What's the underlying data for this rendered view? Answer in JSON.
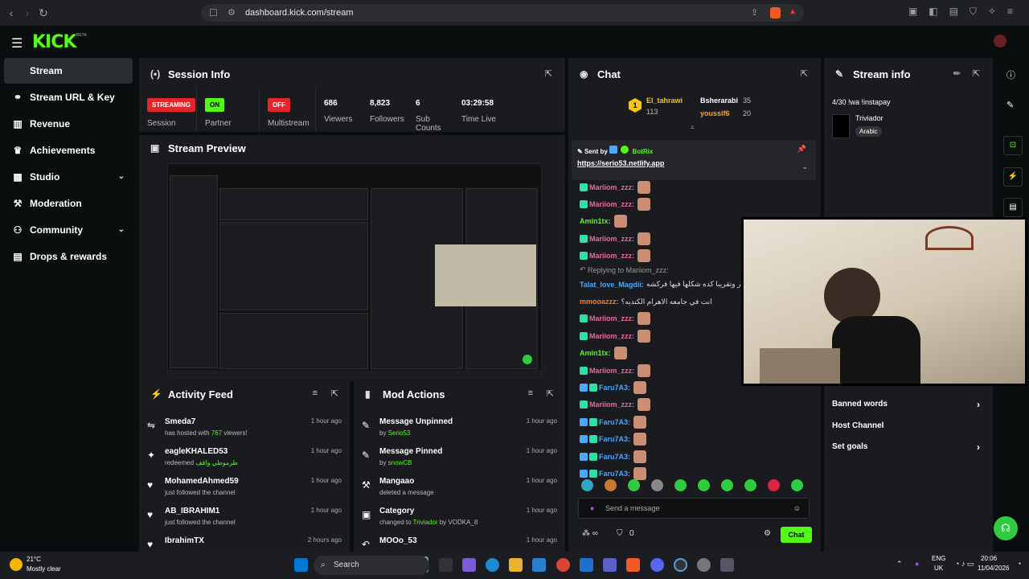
{
  "browser": {
    "url": "dashboard.kick.com/stream"
  },
  "brand": {
    "logo": "KICK",
    "logo_sup": "BETA"
  },
  "sidebar": {
    "items": [
      {
        "label": "Stream",
        "icon": "broadcast-icon"
      },
      {
        "label": "Stream URL & Key",
        "icon": "link-icon"
      },
      {
        "label": "Revenue",
        "icon": "revenue-icon"
      },
      {
        "label": "Achievements",
        "icon": "trophy-icon"
      },
      {
        "label": "Studio",
        "icon": "grid-icon",
        "has_chevron": true
      },
      {
        "label": "Moderation",
        "icon": "hammer-icon"
      },
      {
        "label": "Community",
        "icon": "community-icon",
        "has_chevron": true
      },
      {
        "label": "Drops & rewards",
        "icon": "gift-icon"
      }
    ]
  },
  "session": {
    "title": "Session Info",
    "cells": [
      {
        "badge": "STREAMING",
        "label": "Session"
      },
      {
        "badge": "ON",
        "label": "Partner"
      },
      {
        "badge": "OFF",
        "label": "Multistream"
      },
      {
        "value": "686",
        "label": "Viewers"
      },
      {
        "value": "8,823",
        "label": "Followers"
      },
      {
        "value": "6",
        "label": "Sub Counts"
      },
      {
        "value": "03:29:58",
        "label": "Time Live"
      }
    ]
  },
  "preview": {
    "title": "Stream Preview"
  },
  "activity": {
    "title": "Activity Feed",
    "items": [
      {
        "name": "Smeda7",
        "pre": "has hosted with ",
        "hl": "767",
        "post": " viewers!",
        "time": "1 hour ago"
      },
      {
        "name": "eagleKHALED53",
        "pre": "redeemed ",
        "hl": "طرموطي واقف",
        "post": "",
        "time": "1 hour ago"
      },
      {
        "name": "MohamedAhmed59",
        "pre": "just followed the channel",
        "hl": "",
        "post": "",
        "time": "1 hour ago"
      },
      {
        "name": "AB_IBRAHIM1",
        "pre": "just followed the channel",
        "hl": "",
        "post": "",
        "time": "1 hour ago"
      },
      {
        "name": "IbrahimTX",
        "pre": "",
        "hl": "",
        "post": "",
        "time": "2 hours ago"
      }
    ]
  },
  "mod": {
    "title": "Mod Actions",
    "items": [
      {
        "name": "Message Unpinned",
        "pre": "by ",
        "hl": "Serio53",
        "post": "",
        "time": "1 hour ago"
      },
      {
        "name": "Message Pinned",
        "pre": "by ",
        "hl": "snowCB",
        "post": "",
        "time": "1 hour ago"
      },
      {
        "name": "Mangaao",
        "pre": "deleted a message",
        "hl": "",
        "post": "",
        "time": "1 hour ago"
      },
      {
        "name": "Category",
        "pre": "changed to ",
        "hl": "Triviador",
        "post": " by VODKA_8",
        "time": "1 hour ago"
      },
      {
        "name": "MOOo_53",
        "pre": "",
        "hl": "",
        "post": "",
        "time": "1 hour ago"
      }
    ]
  },
  "chat": {
    "title": "Chat",
    "leaders": [
      {
        "name": "El_tahrawi",
        "count": "113"
      },
      {
        "name": "Bsherarabi",
        "count": "35"
      },
      {
        "name": "youssif6",
        "count": "20"
      }
    ],
    "pinned": {
      "sent_by": "Sent by",
      "user": "BotRix",
      "link": "https://serio53.netlify.app"
    },
    "reply": "Replying to Mariiom_zzz:",
    "messages": [
      {
        "user": "Mariiom_zzz:",
        "color": "#e76aa2"
      },
      {
        "user": "Mariiom_zzz:",
        "color": "#e76aa2"
      },
      {
        "user": "Amin1tx:",
        "color": "#53fc18"
      },
      {
        "user": "Mariiom_zzz:",
        "color": "#e76aa2"
      },
      {
        "user": "Mariiom_zzz:",
        "color": "#e76aa2"
      },
      {
        "user": "Talat_love_Magdii:",
        "color": "#4aa8ff",
        "text": "كدا حوار وتقريبا كده شكلها فيها فركشه"
      },
      {
        "user": "mmooazzz:",
        "color": "#ff7a1a",
        "text": "انت في جامعه الاهرام الكنديه؟"
      },
      {
        "user": "Mariiom_zzz:",
        "color": "#e76aa2"
      },
      {
        "user": "Mariiom_zzz:",
        "color": "#e76aa2"
      },
      {
        "user": "Amin1tx:",
        "color": "#53fc18"
      },
      {
        "user": "Mariiom_zzz:",
        "color": "#e76aa2"
      },
      {
        "user": "Faru7A3:",
        "color": "#4aa8ff"
      },
      {
        "user": "Mariiom_zzz:",
        "color": "#e76aa2"
      },
      {
        "user": "Faru7A3:",
        "color": "#4aa8ff"
      },
      {
        "user": "Faru7A3:",
        "color": "#4aa8ff"
      },
      {
        "user": "Faru7A3:",
        "color": "#4aa8ff"
      },
      {
        "user": "Faru7A3:",
        "color": "#4aa8ff"
      }
    ],
    "placeholder": "Send a message",
    "send": "Chat",
    "points": "0"
  },
  "stream_info": {
    "title": "Stream info",
    "stream_title": "4/30 !wa !instapay",
    "category": "Triviador",
    "language": "Arabic",
    "links": [
      "Banned words",
      "Host Channel",
      "Set goals"
    ]
  },
  "taskbar": {
    "temp": "21°C",
    "weather": "Mostly clear",
    "search": "Search",
    "lang1": "ENG",
    "lang2": "UK",
    "time": "20:06",
    "date": "11/04/2026"
  }
}
